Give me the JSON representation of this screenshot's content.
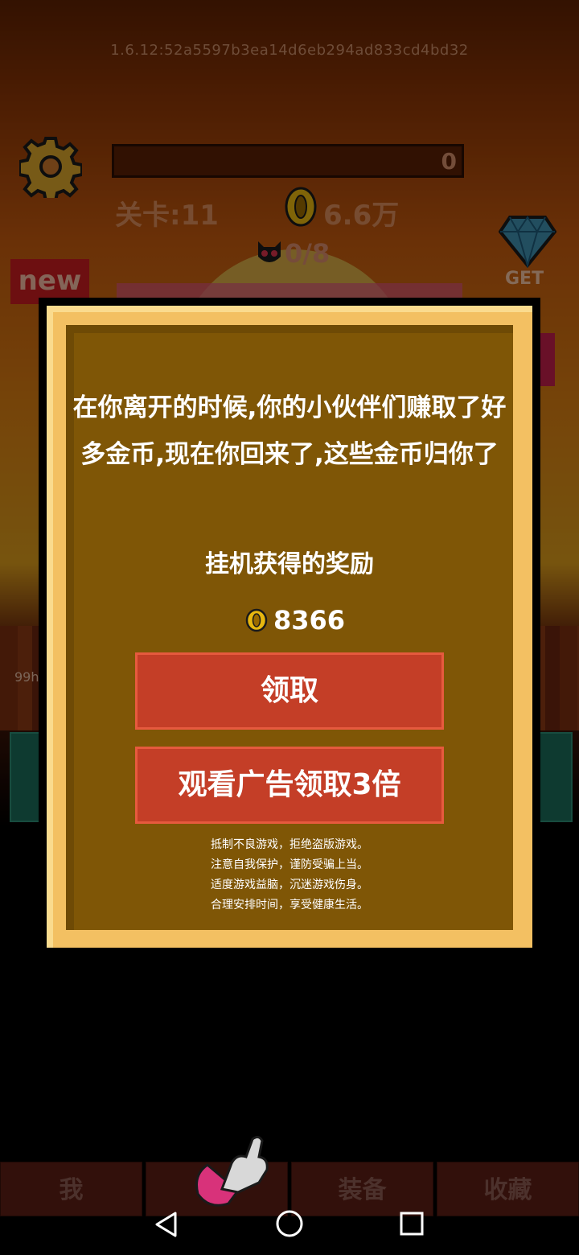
{
  "header": {
    "version": "1.6.12:52a5597b3ea14d6eb294ad833cd4bd32",
    "progress_value": "0",
    "progress_fraction": 0,
    "level": "关卡:11",
    "coins": "6.6万",
    "kills": "0/8",
    "new_badge": "new",
    "get_label": "GET",
    "hp_text": "99h"
  },
  "modal": {
    "message": "在你离开的时候,你的小伙伴们赚取了好多金币,现在你回来了,这些金币归你了",
    "subtitle": "挂机获得的奖励",
    "reward_amount": "8366",
    "claim_label": "领取",
    "triple_label": "观看广告领取3倍",
    "notice_lines": [
      "抵制不良游戏，拒绝盗版游戏。",
      "注意自我保护，谨防受骗上当。",
      "适度游戏益脑，沉迷游戏伤身。",
      "合理安排时间，享受健康生活。"
    ]
  },
  "nav": {
    "tabs": [
      "我",
      "",
      "装备",
      "收藏"
    ]
  },
  "colors": {
    "button_red": "#c43e27",
    "modal_brown": "#7f5606",
    "frame_gold": "#f3c062"
  },
  "icons": [
    "gear-icon",
    "coin-icon",
    "devil-icon",
    "diamond-icon",
    "pointer-hand-icon",
    "back-icon",
    "home-icon",
    "recent-apps-icon"
  ]
}
